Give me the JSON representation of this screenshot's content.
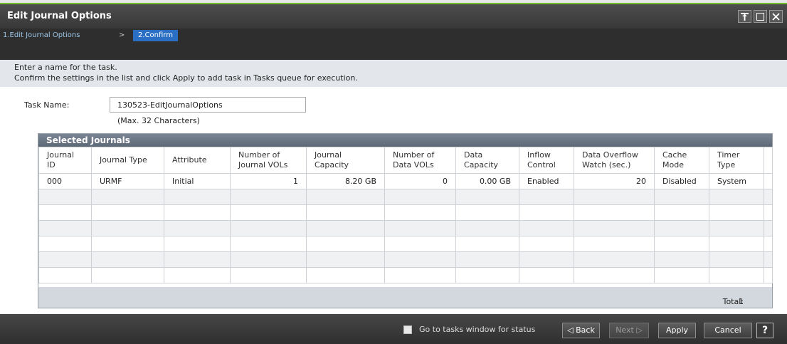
{
  "window": {
    "title": "Edit Journal Options",
    "controls": [
      "pin-icon",
      "maximize-icon",
      "close-icon"
    ]
  },
  "wizard": {
    "step1": "1.Edit Journal Options",
    "separator": ">",
    "step2": "2.Confirm"
  },
  "instructions": {
    "line1": "Enter a name for the task.",
    "line2": "Confirm the settings in the list and click Apply to add task in Tasks queue for execution."
  },
  "task": {
    "label": "Task Name:",
    "value": "130523-EditJournalOptions",
    "hint": "(Max. 32 Characters)"
  },
  "table": {
    "title": "Selected Journals",
    "columns": [
      "Journal ID",
      "Journal Type",
      "Attribute",
      "Number of Journal VOLs",
      "Journal Capacity",
      "Number of Data VOLs",
      "Data Capacity",
      "Inflow Control",
      "Data Overflow Watch (sec.)",
      "Cache Mode",
      "Timer Type"
    ],
    "rows": [
      [
        "000",
        "URMF",
        "Initial",
        "1",
        "8.20 GB",
        "0",
        "0.00 GB",
        "Enabled",
        "20",
        "Disabled",
        "System"
      ]
    ],
    "total_label": "Total:",
    "total_value": "1"
  },
  "footer": {
    "checkbox_label": "Go to tasks window for status",
    "back": "◁ Back",
    "next": "Next ▷",
    "apply": "Apply",
    "cancel": "Cancel",
    "help": "?"
  },
  "colors": {
    "accent_green": "#6dbf2a",
    "active_step": "#2a6fc4",
    "titlebar": "#404040"
  }
}
